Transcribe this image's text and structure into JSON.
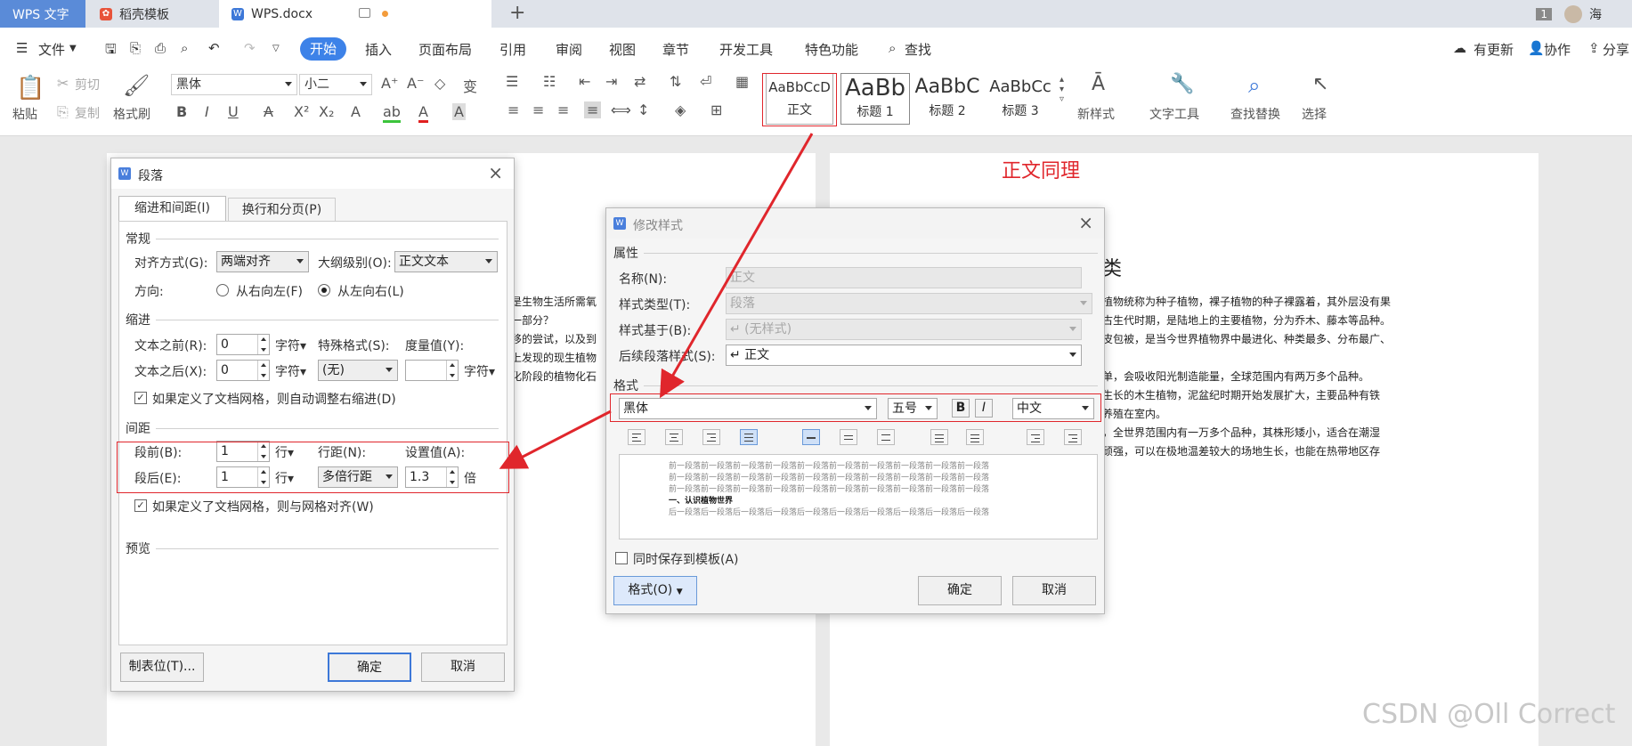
{
  "tabs": {
    "app": "WPS 文字",
    "template": "稻壳模板",
    "doc": "WPS.docx"
  },
  "topright": {
    "badge": "1",
    "user": "海"
  },
  "menu": {
    "file": "文件",
    "start": "开始",
    "items": [
      "插入",
      "页面布局",
      "引用",
      "审阅",
      "视图",
      "章节",
      "开发工具",
      "特色功能",
      "查找"
    ],
    "right": [
      "有更新",
      "协作",
      "分享"
    ]
  },
  "ribbon": {
    "paste": "粘贴",
    "cut": "剪切",
    "copy": "复制",
    "format_painter": "格式刷",
    "font": "黑体",
    "size": "小二",
    "styles": [
      {
        "sample": "AaBbCcD",
        "label": "正文"
      },
      {
        "sample": "AaBb",
        "label": "标题 1"
      },
      {
        "sample": "AaBbC",
        "label": "标题 2"
      },
      {
        "sample": "AaBbCc",
        "label": "标题 3"
      }
    ],
    "new_style": "新样式",
    "text_tools": "文字工具",
    "find_replace": "查找替换",
    "select": "选择"
  },
  "annotation": "正文同理",
  "doc_left_lines": [
    "是生物生活所需氧",
    "一部分？",
    "移的尝试，以及到",
    "上发现的现生植物",
    "化阶段的植物化石"
  ],
  "doc_right": {
    "heading_tail": "类",
    "lines": [
      "植物统称为种子植物，裸子植物的种子裸露着，其外层没有果",
      "古生代时期，是陆地上的主要植物，分为乔木、藤本等品种。",
      "皮包被，是当今世界植物界中最进化、种类最多、分布最广、",
      "单，会吸收阳光制造能量，全球范围内有两万多个品种。",
      "生长的木生植物，泥盆纪时期开始发展扩大，主要品种有铁",
      "养殖在室内。",
      "，全世界范围内有一万多个品种，其株形矮小，适合在潮湿",
      "顽强，可以在极地温差较大的场地生长，也能在热带地区存"
    ]
  },
  "para_dialog": {
    "title": "段落",
    "tabs": [
      "缩进和间距(I)",
      "换行和分页(P)"
    ],
    "general": "常规",
    "align_label": "对齐方式(G):",
    "align_value": "两端对齐",
    "outline_label": "大纲级别(O):",
    "outline_value": "正文文本",
    "direction_label": "方向:",
    "rtl": "从右向左(F)",
    "ltr": "从左向右(L)",
    "indent": "缩进",
    "before_text_label": "文本之前(R):",
    "before_text_value": "0",
    "after_text_label": "文本之后(X):",
    "after_text_value": "0",
    "char_unit": "字符",
    "special_label": "特殊格式(S):",
    "special_value": "(无)",
    "measure_label": "度量值(Y):",
    "measure_value": "",
    "grid_indent_check": "如果定义了文档网格，则自动调整右缩进(D)",
    "spacing": "间距",
    "before_label": "段前(B):",
    "before_value": "1",
    "after_label": "段后(E):",
    "after_value": "1",
    "line_unit": "行",
    "line_spacing_label": "行距(N):",
    "line_spacing_value": "多倍行距",
    "set_value_label": "设置值(A):",
    "set_value": "1.3",
    "times": "倍",
    "grid_align_check": "如果定义了文档网格，则与网格对齐(W)",
    "preview": "预览",
    "tabs_btn": "制表位(T)...",
    "ok": "确定",
    "cancel": "取消"
  },
  "style_dialog": {
    "title": "修改样式",
    "props": "属性",
    "name_label": "名称(N):",
    "name_value": "正文",
    "type_label": "样式类型(T):",
    "type_value": "段落",
    "base_label": "样式基于(B):",
    "base_value": "↵ (无样式)",
    "next_label": "后续段落样式(S):",
    "next_value": "↵ 正文",
    "format": "格式",
    "font_value": "黑体",
    "size_value": "五号",
    "bold": "B",
    "italic": "I",
    "lang_value": "中文",
    "preview_prev": "前一段落前一段落前一段落前一段落前一段落前一段落前一段落前一段落前一段落前一段落",
    "preview_sample": "一、认识植物世界",
    "preview_next": "后一段落后一段落后一段落后一段落后一段落后一段落后一段落后一段落后一段落后一段落",
    "save_template": "同时保存到模板(A)",
    "format_btn": "格式(O)",
    "ok": "确定",
    "cancel": "取消"
  },
  "watermark": "CSDN @Oll Correct",
  "colors": {
    "accent": "#3d82e8",
    "red": "#e0262c",
    "app_tab": "#5a8bd8"
  }
}
